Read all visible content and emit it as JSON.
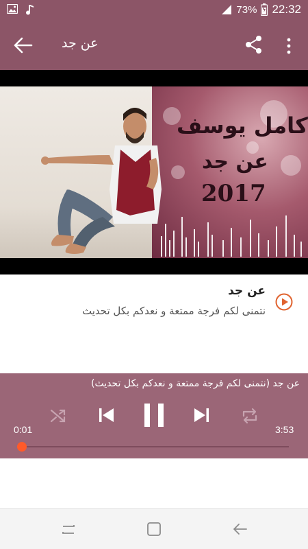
{
  "status_bar": {
    "battery_percent": "73%",
    "time": "22:32",
    "icons": [
      "image-icon",
      "music-icon",
      "signal-icon",
      "battery-icon"
    ]
  },
  "app_bar": {
    "title": "عن جد",
    "icons": [
      "back-arrow-icon",
      "share-icon",
      "more-vert-icon"
    ]
  },
  "video": {
    "cover_title_artist": "كامل يوسف",
    "cover_title_song": "عن جد",
    "cover_year": "2017"
  },
  "track_info": {
    "title": "عن جد",
    "subtitle": "نتمنى لكم فرجة ممتعة و نعدكم بكل تحديث",
    "play_icon": "play-circle-icon"
  },
  "player": {
    "now_playing": "عن جد (نتمنى لكم فرجة ممتعة و نعدكم بكل تحديث)",
    "current_time": "0:01",
    "total_time": "3:53",
    "progress_fraction": 0.004,
    "controls": [
      "shuffle-icon",
      "skip-previous-icon",
      "pause-icon",
      "skip-next-icon",
      "repeat-icon"
    ]
  },
  "nav_bar": {
    "icons": [
      "recent-apps-icon",
      "home-icon",
      "back-icon"
    ]
  },
  "colors": {
    "accent": "#8c5567",
    "player_bg": "#9b6677",
    "progress": "#ff5a2a",
    "play_icon": "#e0632f"
  }
}
